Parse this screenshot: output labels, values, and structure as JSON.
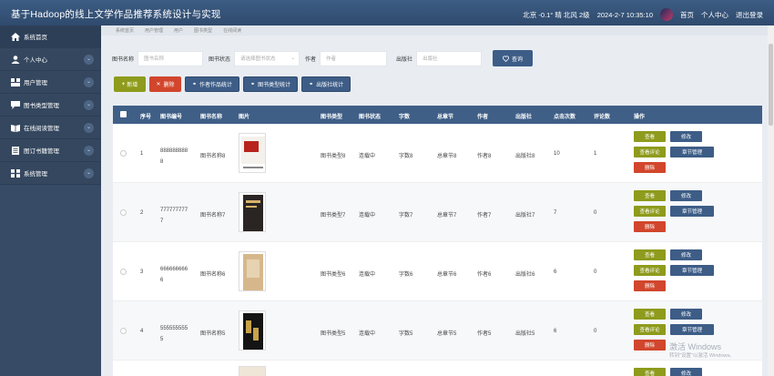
{
  "header": {
    "title": "基于Hadoop的线上文学作品推荐系统设计与实现",
    "weather": "北京  -0.1°  晴  北风  2级",
    "datetime": "2024-2-7 10:35:10",
    "links": [
      "首页",
      "个人中心",
      "退出登录"
    ]
  },
  "sidebar": {
    "items": [
      {
        "label": "系统首页",
        "icon": "home-icon"
      },
      {
        "label": "个人中心",
        "icon": "user-icon"
      },
      {
        "label": "用户管理",
        "icon": "users-icon"
      },
      {
        "label": "图书类型管理",
        "icon": "chat-icon"
      },
      {
        "label": "在线阅读管理",
        "icon": "book-open-icon"
      },
      {
        "label": "图订书籍管理",
        "icon": "document-icon"
      },
      {
        "label": "系统管理",
        "icon": "grid-icon"
      }
    ]
  },
  "breadcrumb": [
    "系统首页",
    "用户管理",
    "用户",
    "图书类型",
    "在线阅读"
  ],
  "search": {
    "name_label": "图书名称",
    "name_placeholder": "图书名称",
    "status_label": "图书状态",
    "status_placeholder": "请选择图书状态",
    "author_label": "作者",
    "author_placeholder": "作者",
    "publisher_label": "出版社",
    "publisher_placeholder": "出版社",
    "button": "查询"
  },
  "toolbar": {
    "add": "新增",
    "delete": "删除",
    "stats": [
      "作者作品统计",
      "图书类型统计",
      "出版社统计"
    ]
  },
  "table": {
    "headers": [
      "序号",
      "图书编号",
      "图书名称",
      "图片",
      "图书类型",
      "图书状态",
      "字数",
      "总章节",
      "作者",
      "出版社",
      "点击次数",
      "评论数",
      "操作"
    ],
    "actions": {
      "view": "查看",
      "edit": "修改",
      "comments": "查看评论",
      "chapters": "章节管理",
      "delete": "删除"
    },
    "rows": [
      {
        "no": "1",
        "code1": "888888888",
        "code2": "8",
        "name": "图书名称8",
        "type": "图书类型8",
        "status": "连载中",
        "words": "字数8",
        "chapters": "总章节8",
        "author": "作者8",
        "publisher": "出版社8",
        "clicks": "10",
        "comments": "1"
      },
      {
        "no": "2",
        "code1": "777777777",
        "code2": "7",
        "name": "图书名称7",
        "type": "图书类型7",
        "status": "连载中",
        "words": "字数7",
        "chapters": "总章节7",
        "author": "作者7",
        "publisher": "出版社7",
        "clicks": "7",
        "comments": "0"
      },
      {
        "no": "3",
        "code1": "666666666",
        "code2": "6",
        "name": "图书名称6",
        "type": "图书类型6",
        "status": "连载中",
        "words": "字数6",
        "chapters": "总章节6",
        "author": "作者6",
        "publisher": "出版社6",
        "clicks": "6",
        "comments": "0"
      },
      {
        "no": "4",
        "code1": "555555555",
        "code2": "5",
        "name": "图书名称5",
        "type": "图书类型5",
        "status": "连载中",
        "words": "字数5",
        "chapters": "总章节5",
        "author": "作者5",
        "publisher": "出版社5",
        "clicks": "6",
        "comments": "0"
      }
    ]
  },
  "watermark": {
    "line1": "激活 Windows",
    "line2": "转到\"设置\"以激活 Windows。"
  },
  "colors": {
    "topbar": "#3d5d84",
    "sidebar": "#374b66",
    "accent_blue": "#3d5d87",
    "olive": "#8e9b1c",
    "danger": "#d1462c"
  }
}
